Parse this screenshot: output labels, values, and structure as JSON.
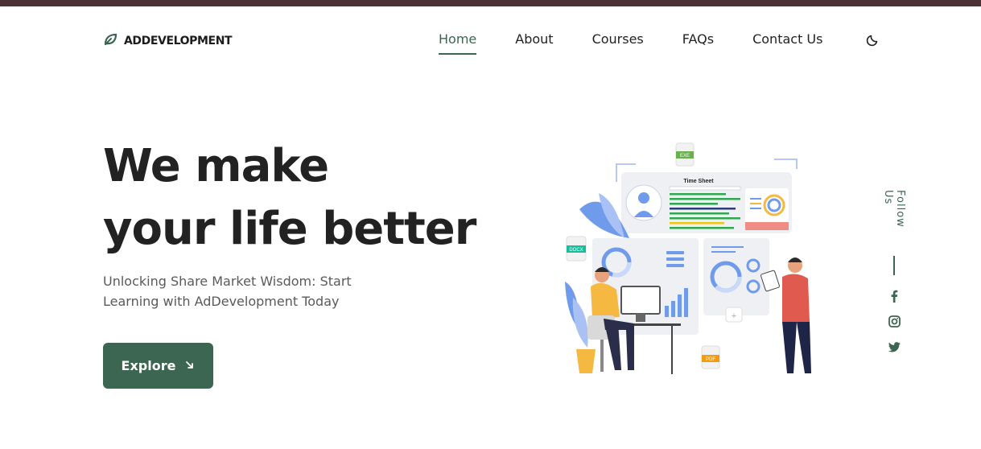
{
  "brand": {
    "name": "ADDEVELOPMENT",
    "icon": "leaf-icon"
  },
  "nav": {
    "items": [
      {
        "label": "Home",
        "active": true
      },
      {
        "label": "About",
        "active": false
      },
      {
        "label": "Courses",
        "active": false
      },
      {
        "label": "FAQs",
        "active": false
      },
      {
        "label": "Contact Us",
        "active": false
      }
    ],
    "theme_icon": "moon-icon"
  },
  "hero": {
    "title_line1": "We make",
    "title_line2": "your life better",
    "subtitle": "Unlocking Share Market Wisdom: Start Learning with AdDevelopment Today",
    "button_label": "Explore",
    "button_icon": "arrow-down-right-icon"
  },
  "illustration": {
    "sheet_title": "Time Sheet",
    "file_labels": {
      "exe": "EXE",
      "docx": "DOCX",
      "pdf": "PDF"
    }
  },
  "social": {
    "label": "Follow Us",
    "icons": [
      "facebook-icon",
      "instagram-icon",
      "twitter-icon"
    ]
  },
  "colors": {
    "accent": "#3d6652",
    "topbar": "#4b3239",
    "text": "#222222"
  }
}
